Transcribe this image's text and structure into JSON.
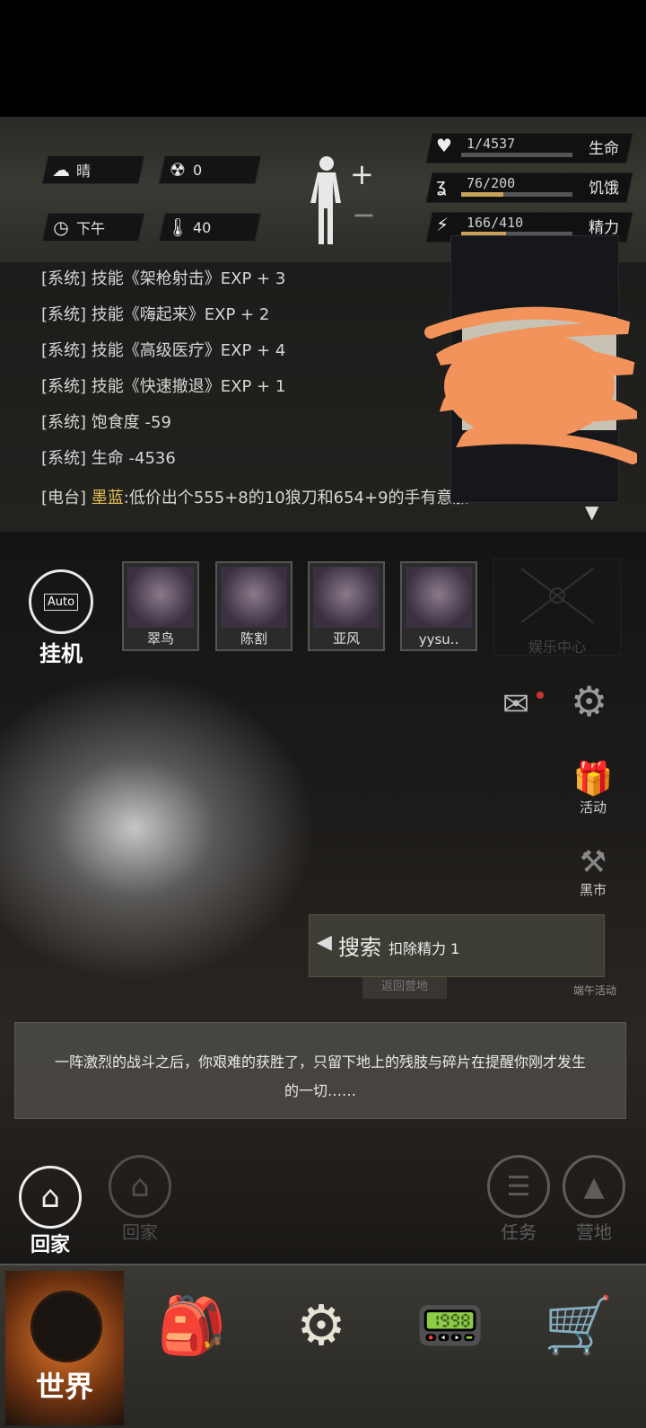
{
  "status": {
    "weather_label": "晴",
    "radiation_value": "0",
    "time_label": "下午",
    "temperature_value": "40",
    "health": {
      "value": "1/4537",
      "label": "生命",
      "fill": 0.0002
    },
    "hunger": {
      "value": "76/200",
      "label": "饥饿",
      "fill": 0.38
    },
    "energy": {
      "value": "166/410",
      "label": "精力",
      "fill": 0.4
    }
  },
  "log": {
    "lines": [
      {
        "tag": "[系统]",
        "text": "技能《架枪射击》EXP + 3"
      },
      {
        "tag": "[系统]",
        "text": "技能《嗨起来》EXP + 2"
      },
      {
        "tag": "[系统]",
        "text": "技能《高级医疗》EXP + 4"
      },
      {
        "tag": "[系统]",
        "text": "技能《快速撤退》EXP + 1"
      },
      {
        "tag": "[系统]",
        "text": "饱食度 -59"
      },
      {
        "tag": "[系统]",
        "text": "生命 -4536"
      }
    ],
    "radio": {
      "tag": "[电台]",
      "speaker": "墨蓝",
      "text": ":低价出个555+8的10狼刀和654+9的手有意加"
    }
  },
  "auto": {
    "badge": "Auto",
    "label": "挂机"
  },
  "party": [
    {
      "name": "翠鸟"
    },
    {
      "name": "陈割"
    },
    {
      "name": "亚风"
    },
    {
      "name": "yysu.."
    }
  ],
  "entertainment_label": "娱乐中心",
  "side": {
    "activity": "活动",
    "black_market": "黑市",
    "dragon_boat": "端午活动"
  },
  "search": {
    "label": "搜索",
    "cost": "扣除精力 1"
  },
  "scene_sign": "返回营地",
  "message": "一阵激烈的战斗之后，你艰难的获胜了，只留下地上的残肢与碎片在提醒你刚才发生的一切……",
  "actions": {
    "home_main": "回家",
    "home_ghost": "回家",
    "tasks": "任务",
    "camp": "营地"
  },
  "nav": {
    "world": "世界"
  }
}
